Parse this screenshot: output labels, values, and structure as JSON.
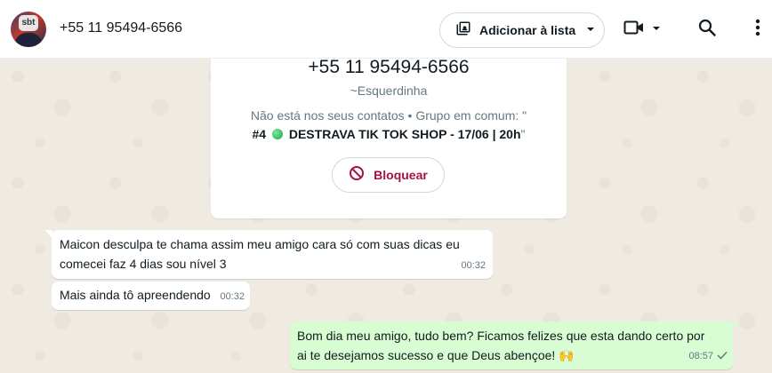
{
  "header": {
    "contact_phone": "+55 11 95494-6566",
    "avatar_text": "sbt",
    "add_to_list_label": "Adicionar à lista",
    "icons": [
      "add-to-list-icon",
      "caret-down-icon",
      "video-call-icon",
      "search-icon",
      "menu-icon"
    ]
  },
  "info_card": {
    "phone": "+55 11 95494-6566",
    "username": "~Esquerdinha",
    "not_contact_text": "Não está nos seus contatos • Grupo em comum: \"",
    "group_prefix": "#4",
    "group_name": "DESTRAVA TIK TOK SHOP - 17/06 | 20h",
    "group_suffix": "\"",
    "block_label": "Bloquear"
  },
  "messages": [
    {
      "direction": "incoming",
      "line1": "Maicon desculpa te chama assim meu amigo cara só com suas dicas eu",
      "line2": "comecei faz 4 dias sou nível 3",
      "time": "00:32"
    },
    {
      "direction": "incoming",
      "line1": "Mais ainda tô apreendendo",
      "time": "00:32"
    },
    {
      "direction": "outgoing",
      "line1": "Bom dia meu amigo, tudo bem? Ficamos felizes que esta dando certo por",
      "line2": "ai te desejamos sucesso e que Deus abençoe! 🙌",
      "time": "08:57",
      "status": "sent"
    }
  ],
  "colors": {
    "chat_background": "#efeae2",
    "outgoing_bubble": "#d9fdd3",
    "block_accent": "#a5123e"
  }
}
